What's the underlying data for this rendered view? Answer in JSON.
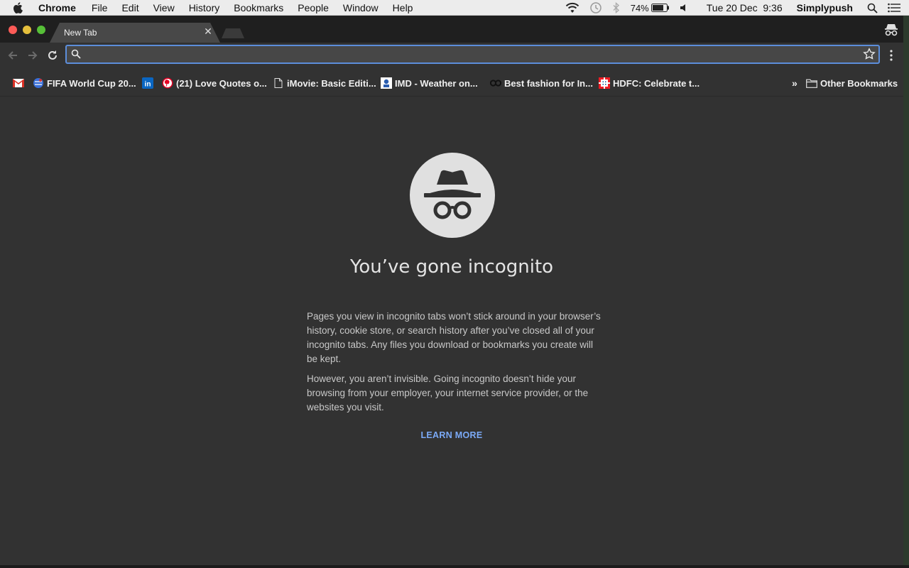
{
  "menubar": {
    "app_name": "Chrome",
    "items": [
      "File",
      "Edit",
      "View",
      "History",
      "Bookmarks",
      "People",
      "Window",
      "Help"
    ],
    "battery": "74%",
    "datetime": "Tue 20 Dec  9:36",
    "user": "Simplypush",
    "icons": [
      "apple-icon",
      "wifi-icon",
      "time-machine-icon",
      "bluetooth-icon",
      "battery-icon",
      "volume-icon",
      "spotlight-icon",
      "notification-center-icon"
    ]
  },
  "tab": {
    "title": "New Tab"
  },
  "toolbar": {
    "omnibox_value": ""
  },
  "bookmarks": {
    "items": [
      {
        "label": "",
        "icon": "gmail-icon"
      },
      {
        "label": "FIFA World Cup 20...",
        "icon": "fifa-icon"
      },
      {
        "label": "",
        "icon": "linkedin-icon"
      },
      {
        "label": "(21) Love Quotes o...",
        "icon": "pinterest-icon"
      },
      {
        "label": "iMovie: Basic Editi...",
        "icon": "page-icon"
      },
      {
        "label": "IMD - Weather on...",
        "icon": "imd-icon"
      },
      {
        "label": "Best fashion for In...",
        "icon": "fashion-icon"
      },
      {
        "label": "HDFC: Celebrate t...",
        "icon": "hdfc-icon"
      }
    ],
    "overflow": "»",
    "other": "Other Bookmarks"
  },
  "page": {
    "headline": "You’ve gone incognito",
    "para1": "Pages you view in incognito tabs won’t stick around in your browser’s history, cookie store, or search history after you’ve closed all of your incognito tabs. Any files you download or bookmarks you create will be kept.",
    "para2": "However, you aren’t invisible. Going incognito doesn’t hide your browsing from your employer, your internet service provider, or the websites you visit.",
    "learn_more": "LEARN MORE"
  },
  "colors": {
    "accent": "#7baaf7",
    "omnibox_border": "#5c8edb",
    "background": "#323232"
  }
}
